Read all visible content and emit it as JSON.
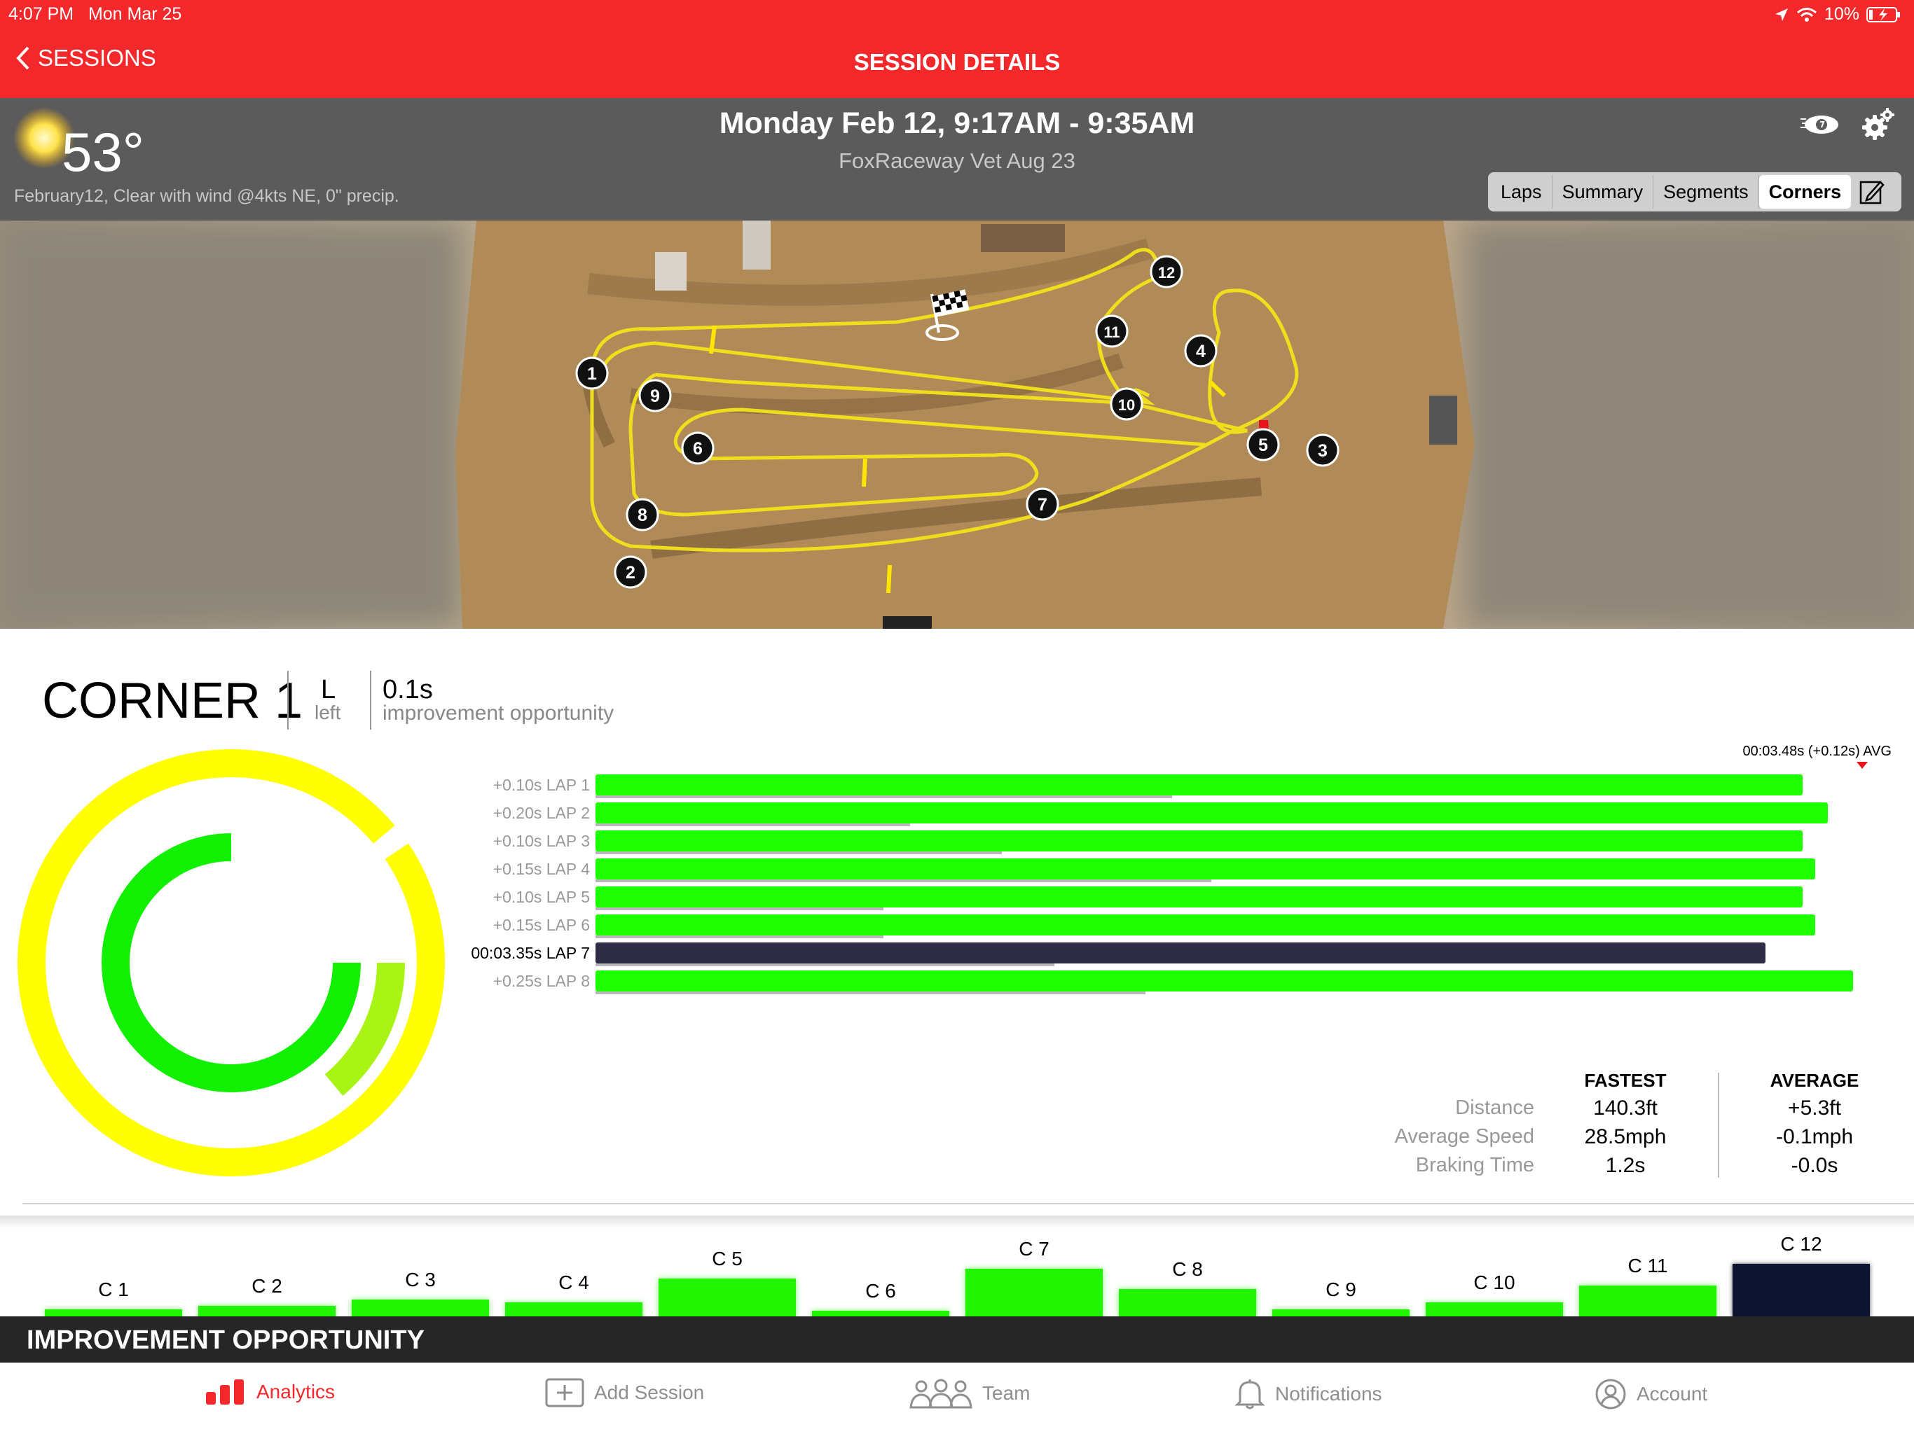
{
  "status_bar": {
    "time": "4:07 PM",
    "date": "Mon Mar 25",
    "battery": "10%"
  },
  "nav": {
    "back_label": "SESSIONS",
    "title": "SESSION DETAILS"
  },
  "weather": {
    "temp": "53°",
    "description": "February12, Clear with wind @4kts NE, 0\" precip."
  },
  "session": {
    "date_range": "Monday Feb 12, 9:17AM - 9:35AM",
    "track": "FoxRaceway Vet Aug 23"
  },
  "tabs": {
    "laps": "Laps",
    "summary": "Summary",
    "segments": "Segments",
    "corners": "Corners",
    "active": "Corners"
  },
  "map": {
    "corner_numbers": [
      "1",
      "2",
      "3",
      "4",
      "5",
      "6",
      "7",
      "8",
      "9",
      "10",
      "11",
      "12"
    ]
  },
  "corner": {
    "title": "CORNER 1",
    "direction_letter": "L",
    "direction_word": "left",
    "improvement_value": "0.1s",
    "improvement_label": "improvement opportunity"
  },
  "lap_chart": {
    "avg_label": "00:03.48s (+0.12s) AVG",
    "laps": [
      {
        "label": "+0.10s LAP 1",
        "fraction": 0.96,
        "gray": 0.44,
        "selected": false
      },
      {
        "label": "+0.20s LAP 2",
        "fraction": 0.98,
        "gray": 0.24,
        "selected": false
      },
      {
        "label": "+0.10s LAP 3",
        "fraction": 0.96,
        "gray": 0.31,
        "selected": false
      },
      {
        "label": "+0.15s LAP 4",
        "fraction": 0.97,
        "gray": 0.47,
        "selected": false
      },
      {
        "label": "+0.10s LAP 5",
        "fraction": 0.96,
        "gray": 0.22,
        "selected": false
      },
      {
        "label": "+0.15s LAP 6",
        "fraction": 0.97,
        "gray": 0.22,
        "selected": false
      },
      {
        "label": "00:03.35s LAP 7",
        "fraction": 0.93,
        "gray": 0.35,
        "selected": true
      },
      {
        "label": "+0.25s LAP 8",
        "fraction": 1.0,
        "gray": 0.42,
        "selected": false
      }
    ],
    "colors": {
      "bar": "#1eff00",
      "selected": "#2e2d45",
      "ring_outer": "#ffff00",
      "ring_inner": "#11f000",
      "ring_mid": "#a8f515"
    }
  },
  "stats": {
    "col_fastest": "FASTEST",
    "col_average": "AVERAGE",
    "rows": [
      {
        "label": "Distance",
        "fastest": "140.3ft",
        "average": "+5.3ft"
      },
      {
        "label": "Average Speed",
        "fastest": "28.5mph",
        "average": "-0.1mph"
      },
      {
        "label": "Braking Time",
        "fastest": "1.2s",
        "average": "-0.0s"
      }
    ]
  },
  "corner_bars": {
    "chart_data": {
      "type": "bar",
      "categories": [
        "C 1",
        "C 2",
        "C 3",
        "C 4",
        "C 5",
        "C 6",
        "C 7",
        "C 8",
        "C 9",
        "C 10",
        "C 11",
        "C 12"
      ],
      "values": [
        0.1,
        0.14,
        0.22,
        0.18,
        0.47,
        0.06,
        0.58,
        0.34,
        0.1,
        0.18,
        0.38,
        0.64
      ],
      "selected": "C 12"
    }
  },
  "improvement_band": {
    "title": "IMPROVEMENT OPPORTUNITY"
  },
  "tabbar": {
    "analytics": "Analytics",
    "add_session": "Add Session",
    "team": "Team",
    "notifications": "Notifications",
    "account": "Account"
  }
}
